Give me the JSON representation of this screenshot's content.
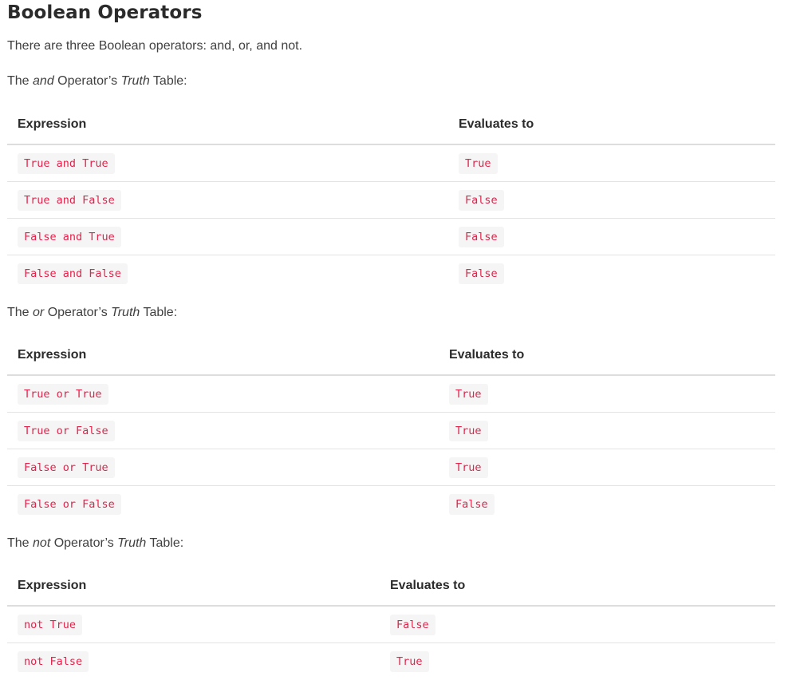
{
  "heading": "Boolean Operators",
  "intro": "There are three Boolean operators: and, or, and not.",
  "tables": [
    {
      "caption_pre": "The ",
      "caption_op": "and",
      "caption_mid": " Operator’s ",
      "caption_truth": "Truth",
      "caption_post": " Table:",
      "headers": [
        "Expression",
        "Evaluates to"
      ],
      "rows": [
        [
          "True and True",
          "True"
        ],
        [
          "True and False",
          "False"
        ],
        [
          "False and True",
          "False"
        ],
        [
          "False and False",
          "False"
        ]
      ]
    },
    {
      "caption_pre": "The ",
      "caption_op": "or",
      "caption_mid": " Operator’s ",
      "caption_truth": "Truth",
      "caption_post": " Table:",
      "headers": [
        "Expression",
        "Evaluates to"
      ],
      "rows": [
        [
          "True or True",
          "True"
        ],
        [
          "True or False",
          "True"
        ],
        [
          "False or True",
          "True"
        ],
        [
          "False or False",
          "False"
        ]
      ]
    },
    {
      "caption_pre": "The ",
      "caption_op": "not",
      "caption_mid": " Operator’s ",
      "caption_truth": "Truth",
      "caption_post": " Table:",
      "headers": [
        "Expression",
        "Evaluates to"
      ],
      "rows": [
        [
          "not True",
          "False"
        ],
        [
          "not False",
          "True"
        ]
      ]
    }
  ],
  "colors": {
    "code_text": "#e0244c",
    "code_background": "#f5f5f5",
    "heading_text": "#2b2b2b",
    "body_text": "#404040",
    "header_rule": "#dddddd",
    "row_rule": "#e3e3e3"
  }
}
